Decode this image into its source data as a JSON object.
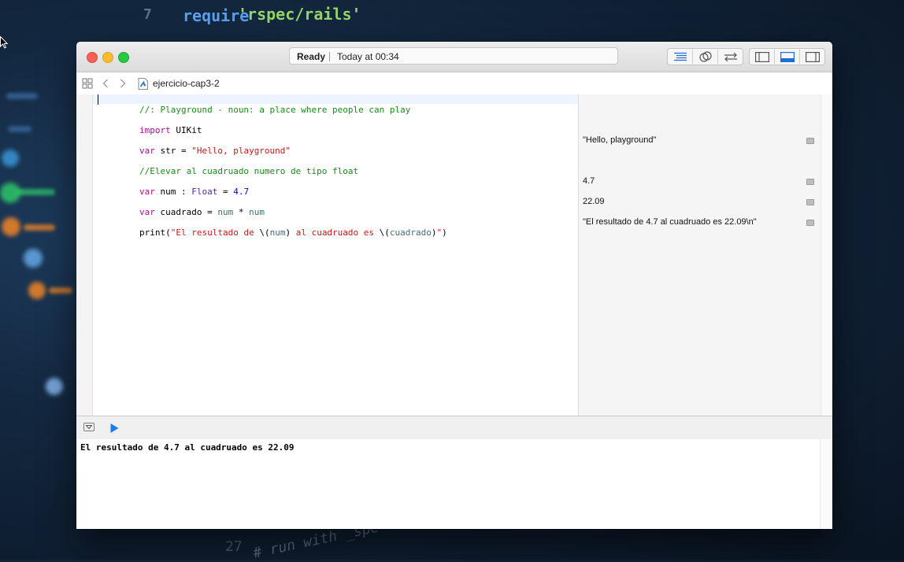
{
  "backdrop": {
    "line_no": "7",
    "keyword": "require",
    "string": "'rspec/rails'",
    "low_text": "# run with _spe",
    "low_num": "27"
  },
  "window": {
    "status": {
      "state": "Ready",
      "time": "Today at 00:34"
    },
    "file_name": "ejercicio-cap3-2",
    "editor_mode_buttons": [
      "standard-editor-icon",
      "assistant-editor-icon",
      "version-editor-icon"
    ],
    "panel_buttons": [
      "navigator-panel-icon",
      "debug-area-icon",
      "utilities-panel-icon"
    ]
  },
  "code": {
    "line1": {
      "comment": "//: Playground - noun: a place where people can play"
    },
    "line2": {
      "kw": "import",
      "rest": " UIKit"
    },
    "line3": {
      "kw": "var",
      "name": " str = ",
      "str": "\"Hello, playground\""
    },
    "line4": {
      "comment": "//Elevar al cuadruado numero de tipo float"
    },
    "line5": {
      "kw": "var",
      "name": " num : ",
      "type": "Float",
      "eq": " = ",
      "num": "4.7"
    },
    "line6": {
      "kw": "var",
      "name": " cuadrado = ",
      "a": "num",
      "op": " * ",
      "b": "num"
    },
    "line7": {
      "fn": "print(",
      "s1": "\"El resultado de ",
      "i1_open": "\\(",
      "i1": "num",
      "i1_close": ")",
      "s2": " al cuadruado es ",
      "i2_open": "\\(",
      "i2": "cuadrado",
      "i2_close": ")",
      "s3": "\"",
      "end": ")"
    }
  },
  "results": {
    "line3": "\"Hello, playground\"",
    "line5": "4.7",
    "line6": "22.09",
    "line7": "\"El resultado de 4.7 al cuadruado es 22.09\\n\""
  },
  "console": {
    "output": "El resultado de 4.7 al cuadruado es 22.09"
  },
  "colors": {
    "comment": "#1a8a1a",
    "keyword": "#aa0d91",
    "string": "#c41a16",
    "number": "#1c00cf",
    "type": "#5c2699",
    "identifier": "#3f6e74",
    "run_button": "#1f7cf0"
  }
}
